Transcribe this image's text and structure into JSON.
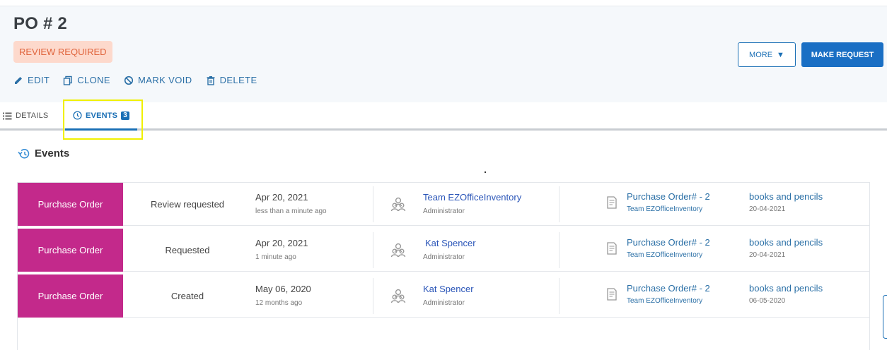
{
  "header": {
    "title": "PO # 2",
    "status_badge": "REVIEW REQUIRED",
    "actions": [
      {
        "label": "EDIT",
        "icon": "pencil-icon"
      },
      {
        "label": "CLONE",
        "icon": "copy-icon"
      },
      {
        "label": "MARK VOID",
        "icon": "ban-icon"
      },
      {
        "label": "DELETE",
        "icon": "trash-icon"
      }
    ],
    "more_label": "MORE",
    "make_request_label": "MAKE REQUEST"
  },
  "tabs": [
    {
      "label": "DETAILS",
      "icon": "list-icon"
    },
    {
      "label": "EVENTS",
      "icon": "history-icon",
      "count": "3",
      "active": true
    }
  ],
  "events_section": {
    "title": "Events",
    "rows": [
      {
        "type": "Purchase Order",
        "action": "Review requested",
        "date": "Apr 20, 2021",
        "ago": "less than a minute ago",
        "user": "Team EZOfficeInventory",
        "role": "Administrator",
        "po": "Purchase Order# - 2",
        "po_team": "Team EZOfficeInventory",
        "item": "books and pencils",
        "item_date": "20-04-2021"
      },
      {
        "type": "Purchase Order",
        "action": "Requested",
        "date": "Apr 20, 2021",
        "ago": "1 minute ago",
        "user": "Kat Spencer",
        "role": "Administrator",
        "po": "Purchase Order# - 2",
        "po_team": "Team EZOfficeInventory",
        "item": "books and pencils",
        "item_date": "20-04-2021"
      },
      {
        "type": "Purchase Order",
        "action": "Created",
        "date": "May 06, 2020",
        "ago": "12 months ago",
        "user": "Kat Spencer",
        "role": "Administrator",
        "po": "Purchase Order# - 2",
        "po_team": "Team EZOfficeInventory",
        "item": "books and pencils",
        "item_date": "06-05-2020"
      }
    ]
  },
  "colors": {
    "accent": "#1a6fb5",
    "event_type_bg": "#c3298b",
    "badge_bg": "#fdd9cc",
    "badge_text": "#e0643c",
    "highlight": "#f0f000"
  }
}
